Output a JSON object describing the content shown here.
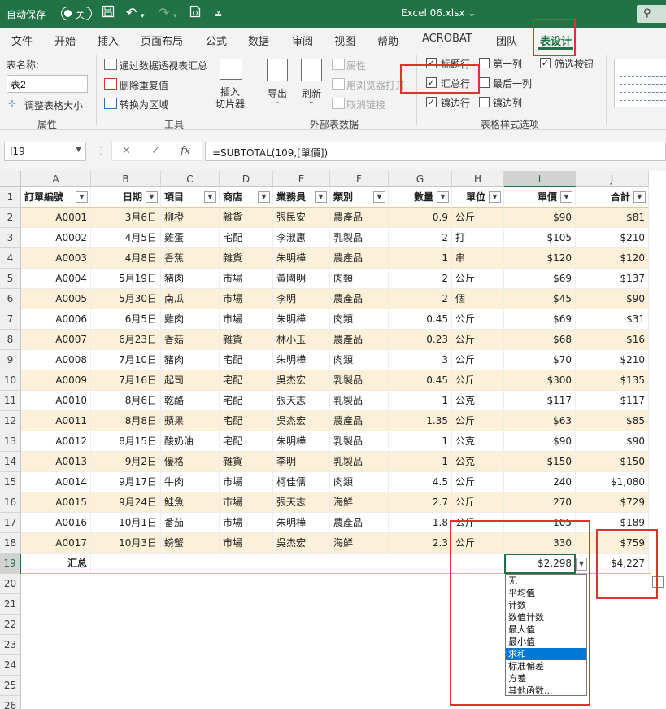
{
  "titlebar": {
    "autosave_label": "自动保存",
    "autosave_state": "关",
    "filename": "Excel 06.xlsx ⌄",
    "search_icon": "⚲"
  },
  "tabs": [
    "文件",
    "开始",
    "插入",
    "页面布局",
    "公式",
    "数据",
    "审阅",
    "视图",
    "帮助",
    "ACROBAT",
    "团队",
    "表设计"
  ],
  "ribbon": {
    "properties": {
      "tablename_label": "表名称:",
      "tablename_value": "表2",
      "resize_label": "调整表格大小",
      "group_label": "属性"
    },
    "tools": {
      "pivot_label": "通过数据透视表汇总",
      "dedupe_label": "删除重复值",
      "convert_label": "转换为区域",
      "slicer_label_1": "插入",
      "slicer_label_2": "切片器",
      "group_label": "工具"
    },
    "external": {
      "export_label": "导出",
      "refresh_label": "刷新",
      "props_label": "属性",
      "browser_label": "用浏览器打开",
      "unlink_label": "取消链接",
      "group_label": "外部表数据"
    },
    "style_options": {
      "header_row": {
        "label": "标题行",
        "checked": true
      },
      "total_row": {
        "label": "汇总行",
        "checked": true
      },
      "banded_rows": {
        "label": "镶边行",
        "checked": true
      },
      "first_column": {
        "label": "第一列",
        "checked": false
      },
      "last_column": {
        "label": "最后一列",
        "checked": false
      },
      "banded_columns": {
        "label": "镶边列",
        "checked": false
      },
      "filter_button": {
        "label": "筛选按钮",
        "checked": true
      },
      "group_label": "表格样式选项"
    }
  },
  "formula_bar": {
    "name_box": "I19",
    "cancel_icon": "✕",
    "enter_icon": "✓",
    "fx_label": "fx",
    "formula": "=SUBTOTAL(109,[單價])"
  },
  "columns": [
    "A",
    "B",
    "C",
    "D",
    "E",
    "F",
    "G",
    "H",
    "I",
    "J"
  ],
  "header_row": [
    "訂單編號",
    "日期",
    "項目",
    "商店",
    "業務員",
    "類別",
    "數量",
    "單位",
    "單價",
    "合計"
  ],
  "rows": [
    [
      "A0001",
      "3月6日",
      "柳橙",
      "雜貨",
      "張民安",
      "農產品",
      "0.9",
      "公斤",
      "$90",
      "$81"
    ],
    [
      "A0002",
      "4月5日",
      "雞蛋",
      "宅配",
      "李淑惠",
      "乳製品",
      "2",
      "打",
      "$105",
      "$210"
    ],
    [
      "A0003",
      "4月8日",
      "香蕉",
      "雜貨",
      "朱明樺",
      "農產品",
      "1",
      "串",
      "$120",
      "$120"
    ],
    [
      "A0004",
      "5月19日",
      "豬肉",
      "市場",
      "黃國明",
      "肉類",
      "2",
      "公斤",
      "$69",
      "$137"
    ],
    [
      "A0005",
      "5月30日",
      "南瓜",
      "市場",
      "李明",
      "農產品",
      "2",
      "個",
      "$45",
      "$90"
    ],
    [
      "A0006",
      "6月5日",
      "雞肉",
      "市場",
      "朱明樺",
      "肉類",
      "0.45",
      "公斤",
      "$69",
      "$31"
    ],
    [
      "A0007",
      "6月23日",
      "香菇",
      "雜貨",
      "林小玉",
      "農產品",
      "0.23",
      "公斤",
      "$68",
      "$16"
    ],
    [
      "A0008",
      "7月10日",
      "豬肉",
      "宅配",
      "朱明樺",
      "肉類",
      "3",
      "公斤",
      "$70",
      "$210"
    ],
    [
      "A0009",
      "7月16日",
      "起司",
      "宅配",
      "吳杰宏",
      "乳製品",
      "0.45",
      "公斤",
      "$300",
      "$135"
    ],
    [
      "A0010",
      "8月6日",
      "乾酪",
      "宅配",
      "張天志",
      "乳製品",
      "1",
      "公克",
      "$117",
      "$117"
    ],
    [
      "A0011",
      "8月8日",
      "蘋果",
      "宅配",
      "吳杰宏",
      "農產品",
      "1.35",
      "公斤",
      "$63",
      "$85"
    ],
    [
      "A0012",
      "8月15日",
      "酸奶油",
      "宅配",
      "朱明樺",
      "乳製品",
      "1",
      "公克",
      "$90",
      "$90"
    ],
    [
      "A0013",
      "9月2日",
      "優格",
      "雜貨",
      "李明",
      "乳製品",
      "1",
      "公克",
      "$150",
      "$150"
    ],
    [
      "A0014",
      "9月17日",
      "牛肉",
      "市場",
      "柯佳儒",
      "肉類",
      "4.5",
      "公斤",
      "240",
      "$1,080"
    ],
    [
      "A0015",
      "9月24日",
      "鮭魚",
      "市場",
      "張天志",
      "海鮮",
      "2.7",
      "公斤",
      "270",
      "$729"
    ],
    [
      "A0016",
      "10月1日",
      "番茄",
      "市場",
      "朱明樺",
      "農產品",
      "1.8",
      "公斤",
      "105",
      "$189"
    ],
    [
      "A0017",
      "10月3日",
      "螃蟹",
      "市場",
      "吳杰宏",
      "海鮮",
      "2.3",
      "公斤",
      "330",
      "$759"
    ]
  ],
  "total_row": {
    "label": "汇总",
    "unit_price_total": "$2,298",
    "total_sum": "$4,227"
  },
  "row_numbers": [
    "1",
    "2",
    "3",
    "4",
    "5",
    "6",
    "7",
    "8",
    "9",
    "10",
    "11",
    "12",
    "13",
    "14",
    "15",
    "16",
    "17",
    "18",
    "19",
    "20",
    "21",
    "22",
    "23",
    "24",
    "25",
    "26"
  ],
  "function_menu": {
    "options": [
      "无",
      "平均值",
      "计数",
      "数值计数",
      "最大值",
      "最小值",
      "求和",
      "标准偏差",
      "方差",
      "其他函数..."
    ],
    "selected_index": 6
  }
}
